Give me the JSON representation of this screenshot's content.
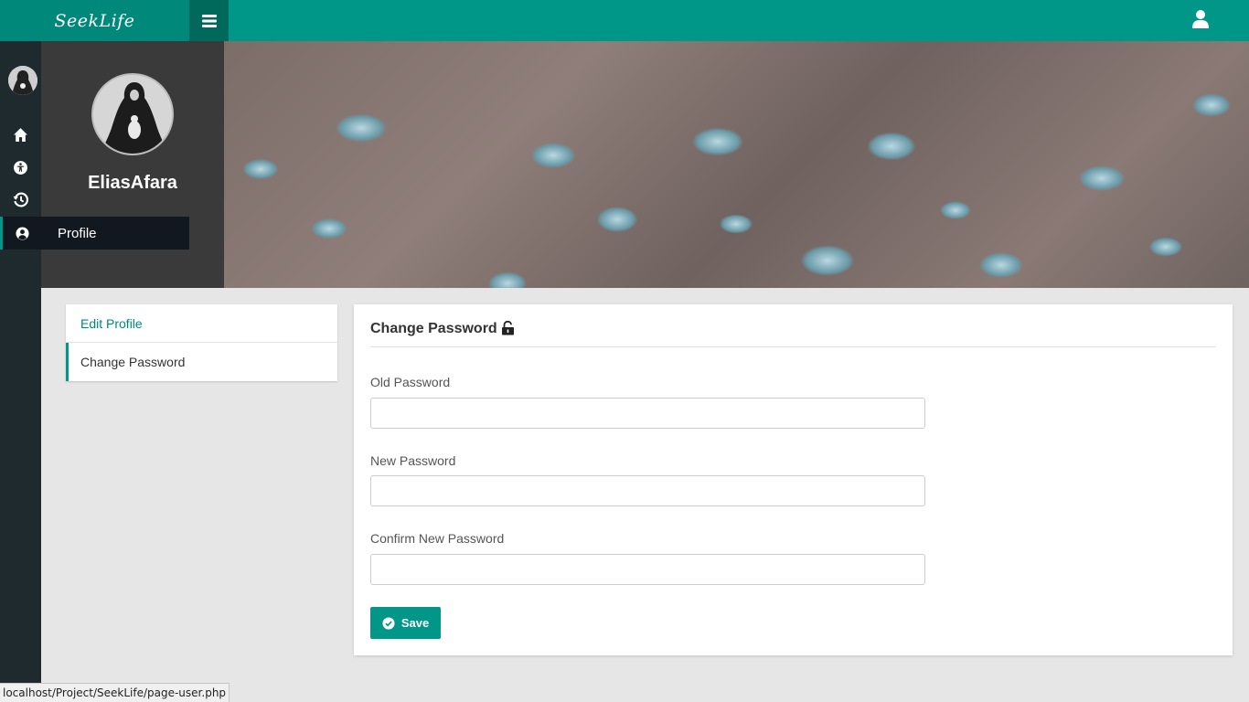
{
  "app": {
    "brand": "SeekLife"
  },
  "user": {
    "name": "EliasAfara"
  },
  "nav": {
    "active_label": "Profile"
  },
  "side_menu": {
    "items": [
      {
        "label": "Edit Profile"
      },
      {
        "label": "Change Password"
      }
    ]
  },
  "form": {
    "title": "Change Password",
    "fields": [
      {
        "label": "Old Password",
        "value": ""
      },
      {
        "label": "New Password",
        "value": ""
      },
      {
        "label": "Confirm New Password",
        "value": ""
      }
    ],
    "save_label": "Save"
  },
  "status_url": "localhost/Project/SeekLife/page-user.php",
  "colors": {
    "primary": "#009688",
    "rail": "#1f2a2f",
    "panel": "#3a3a3a"
  }
}
